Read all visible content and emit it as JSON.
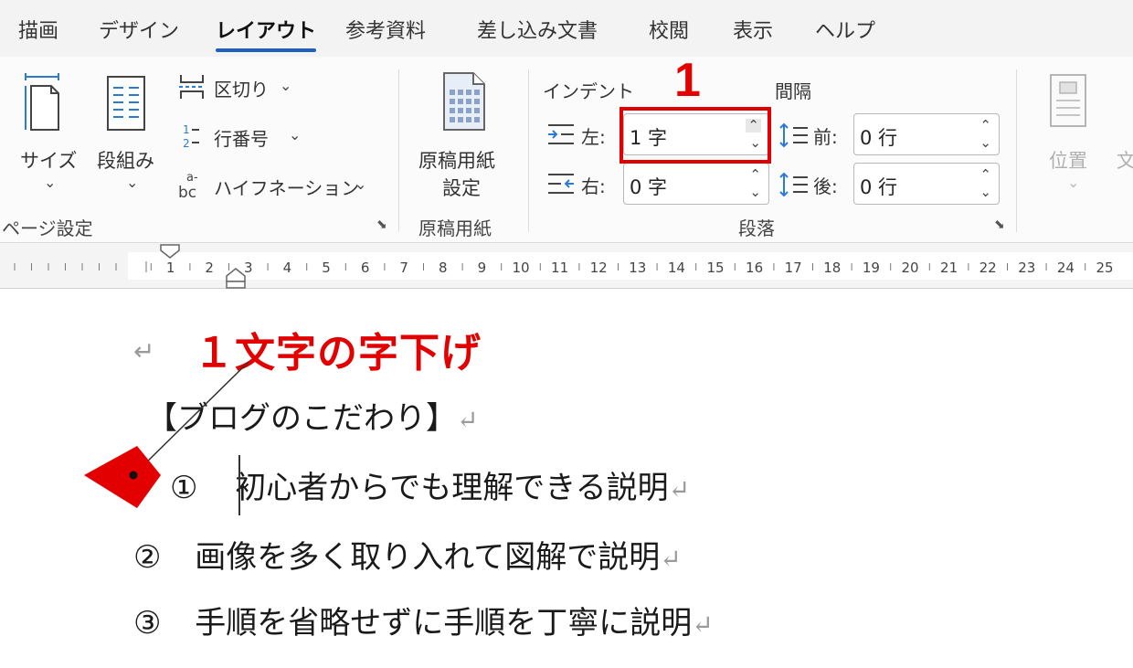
{
  "tabs": [
    {
      "label": "描画"
    },
    {
      "label": "デザイン"
    },
    {
      "label": "レイアウト",
      "active": true
    },
    {
      "label": "参考資料"
    },
    {
      "label": "差し込み文書"
    },
    {
      "label": "校閲"
    },
    {
      "label": "表示"
    },
    {
      "label": "ヘルプ"
    }
  ],
  "page_setup": {
    "size_label": "サイズ",
    "columns_label": "段組み",
    "breaks_label": "区切り",
    "line_numbers_label": "行番号",
    "hyphenation_label": "ハイフネーション",
    "group_label": "ページ設定"
  },
  "genkou": {
    "button_line1": "原稿用紙",
    "button_line2": "設定",
    "group_label": "原稿用紙"
  },
  "paragraph": {
    "indent_heading": "インデント",
    "spacing_heading": "間隔",
    "left_label": "左:",
    "right_label": "右:",
    "before_label": "前:",
    "after_label": "後:",
    "left_value": "1 字",
    "right_value": "0 字",
    "before_value": "0 行",
    "after_value": "0 行",
    "group_label": "段落"
  },
  "arrange": {
    "position_label": "位置",
    "next_label_partial": "文"
  },
  "annotations": {
    "step_number": "1",
    "indent_note": "１文字の字下げ"
  },
  "ruler": {
    "numbers": [
      "1",
      "2",
      "3",
      "4",
      "5",
      "6",
      "7",
      "8",
      "9",
      "10",
      "11",
      "12",
      "13",
      "14",
      "15",
      "16",
      "17",
      "18",
      "19",
      "20",
      "21",
      "22",
      "23",
      "24",
      "25"
    ]
  },
  "document": {
    "heading": "【ブログのこだわり】",
    "items": [
      {
        "marker": "①",
        "text": "初心者からでも理解できる説明"
      },
      {
        "marker": "②",
        "text": "画像を多く取り入れて図解で説明"
      },
      {
        "marker": "③",
        "text": "手順を省略せずに手順を丁寧に説明"
      }
    ],
    "para_mark": "↵"
  },
  "colors": {
    "accent_blue": "#1f5fbf",
    "annotation_red": "#e30000"
  }
}
